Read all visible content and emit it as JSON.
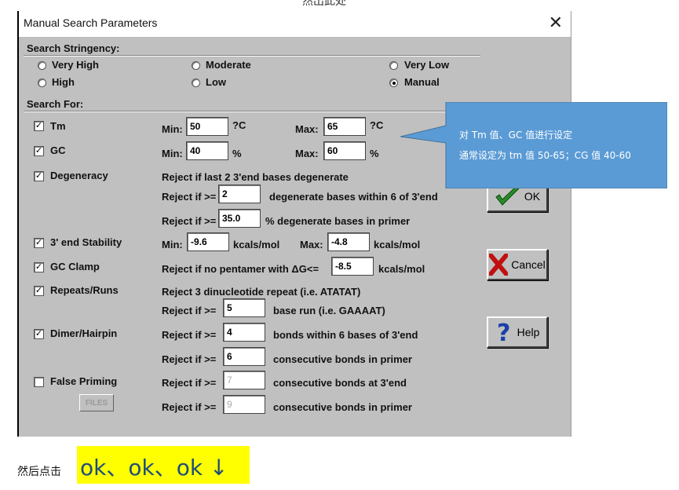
{
  "top_caption": "然出此处",
  "window": {
    "title": "Manual Search Parameters",
    "close_glyph": "✕"
  },
  "stringency": {
    "label": "Search Stringency:",
    "options": [
      "Very High",
      "Moderate",
      "Very Low",
      "High",
      "Low",
      "Manual"
    ],
    "selected": "Manual"
  },
  "search_for": {
    "label": "Search For:",
    "tm": {
      "label": "Tm",
      "checked": true,
      "min_label": "Min:",
      "min": "50",
      "unit": "?C",
      "max_label": "Max:",
      "max": "65"
    },
    "gc": {
      "label": "GC",
      "checked": true,
      "min_label": "Min:",
      "min": "40",
      "unit": "%",
      "max_label": "Max:",
      "max": "60"
    },
    "degeneracy": {
      "label": "Degeneracy",
      "checked": true,
      "line1": "Reject if last 2 3'end bases degenerate",
      "line2_prefix": "Reject if >=",
      "line2_value": "2",
      "line2_suffix": "degenerate bases within 6 of 3'end",
      "line3_prefix": "Reject if >=",
      "line3_value": "35.0",
      "line3_suffix": "% degenerate bases in primer"
    },
    "stability": {
      "label": "3' end Stability",
      "checked": true,
      "min_label": "Min:",
      "min": "-9.6",
      "unit1": "kcals/mol",
      "max_label": "Max:",
      "max": "-4.8",
      "unit2": "kcals/mol"
    },
    "gc_clamp": {
      "label": "GC Clamp",
      "checked": true,
      "prefix": "Reject if no pentamer with ΔG<=",
      "value": "-8.5",
      "unit": "kcals/mol"
    },
    "repeats": {
      "label": "Repeats/Runs",
      "checked": true,
      "line1": "Reject 3 dinucleotide repeat (i.e. ATATAT)",
      "line2_prefix": "Reject if >=",
      "line2_value": "5",
      "line2_suffix": "base run (i.e. GAAAAT)"
    },
    "dimer": {
      "label": "Dimer/Hairpin",
      "checked": true,
      "line1_prefix": "Reject if >=",
      "line1_value": "4",
      "line1_suffix": "bonds within 6 bases of 3'end",
      "line2_prefix": "Reject if >=",
      "line2_value": "6",
      "line2_suffix": "consecutive bonds in primer"
    },
    "false_priming": {
      "label": "False Priming",
      "checked": false,
      "files_label": "FILES",
      "line1_prefix": "Reject if >=",
      "line1_value": "7",
      "line1_suffix": "consecutive bonds at 3'end",
      "line2_prefix": "Reject if >=",
      "line2_value": "9",
      "line2_suffix": "consecutive bonds in primer"
    }
  },
  "buttons": {
    "ok": "OK",
    "cancel": "Cancel",
    "help": "Help"
  },
  "callout": {
    "line1": "对 Tm 值、GC 值进行设定",
    "line2": "通常设定为 tm 值 50-65；CG 值 40-60",
    "fill": "#5b9bd5"
  },
  "bottom": {
    "lead": "然后点击",
    "highlight": "ok、ok、ok  ↓",
    "highlight_color": "#ffff00"
  }
}
